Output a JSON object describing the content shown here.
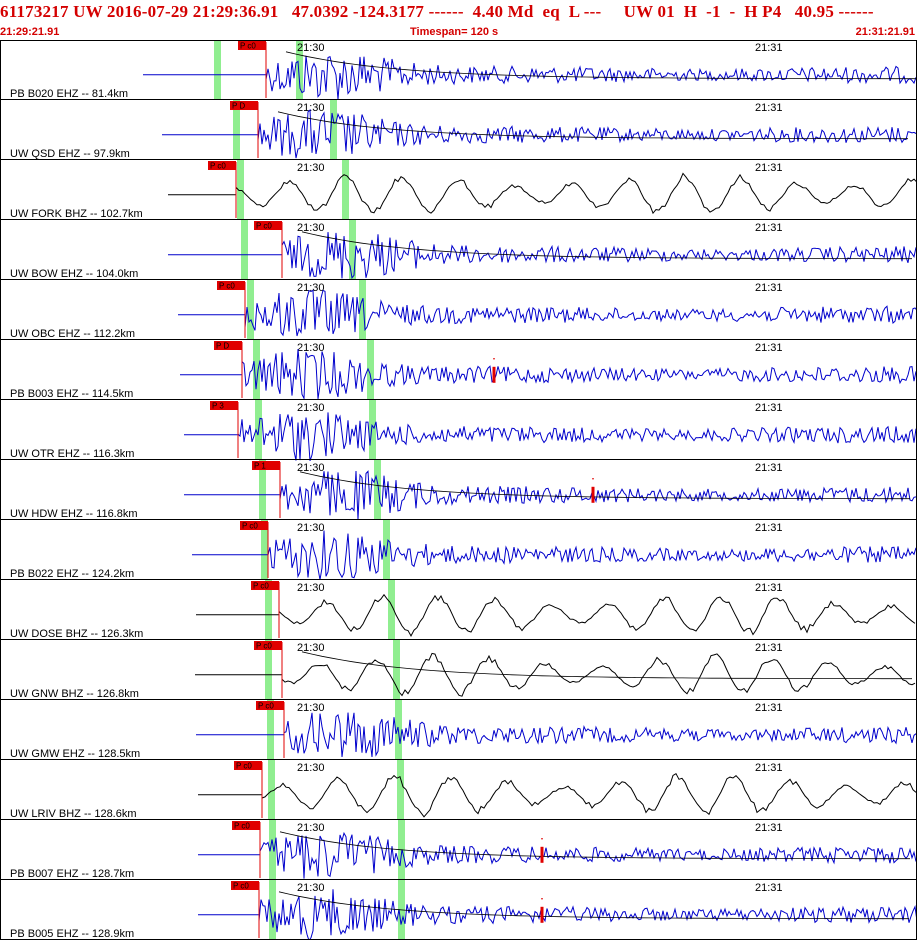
{
  "header": {
    "title": "61173217 UW 2016-07-29 21:29:36.91   47.0392 -124.3177 ------  4.40 Md  eq  L ---     UW 01  H  -1  -  H P4   40.95 ------",
    "start_time": "21:29:21.91",
    "timespan": "Timespan= 120 s",
    "end_time": "21:31:21.91"
  },
  "time_labels": [
    "21:30",
    "21:31"
  ],
  "colors": {
    "header_text": "#d40000",
    "pick_marker": "#e00000",
    "s_window": "#90ee90",
    "waveform_short_period": "#0000cc",
    "waveform_broadband": "#000000",
    "coda_curve": "#000000",
    "border": "#000000"
  },
  "channels": [
    {
      "label": "PB B020 EHZ -- 81.4km",
      "phase": "P c0",
      "type": "short-period",
      "coda": true,
      "s_pick": false
    },
    {
      "label": "UW QSD EHZ -- 97.9km",
      "phase": "P D",
      "type": "short-period",
      "coda": true,
      "s_pick": false
    },
    {
      "label": "UW FORK BHZ -- 102.7km",
      "phase": "P c0",
      "type": "broadband",
      "coda": false,
      "s_pick": false
    },
    {
      "label": "UW BOW EHZ -- 104.0km",
      "phase": "P c0",
      "type": "short-period",
      "coda": true,
      "s_pick": false
    },
    {
      "label": "UW OBC EHZ -- 112.2km",
      "phase": "P c0",
      "type": "short-period",
      "coda": false,
      "s_pick": false
    },
    {
      "label": "PB B003 EHZ -- 114.5km",
      "phase": "P D",
      "type": "short-period",
      "coda": false,
      "s_pick": true
    },
    {
      "label": "UW OTR EHZ -- 116.3km",
      "phase": "P 3",
      "type": "short-period",
      "coda": false,
      "s_pick": false
    },
    {
      "label": "UW HDW EHZ -- 116.8km",
      "phase": "P 1",
      "type": "short-period",
      "coda": true,
      "s_pick": true
    },
    {
      "label": "PB B022 EHZ -- 124.2km",
      "phase": "P c0",
      "type": "short-period",
      "coda": false,
      "s_pick": false
    },
    {
      "label": "UW DOSE BHZ -- 126.3km",
      "phase": "P c0",
      "type": "broadband",
      "coda": false,
      "s_pick": false
    },
    {
      "label": "UW GNW BHZ -- 126.8km",
      "phase": "P c0",
      "type": "broadband",
      "coda": true,
      "s_pick": false
    },
    {
      "label": "UW GMW EHZ -- 128.5km",
      "phase": "P c0",
      "type": "short-period",
      "coda": false,
      "s_pick": false
    },
    {
      "label": "UW LRIV BHZ -- 128.6km",
      "phase": "P c0",
      "type": "broadband",
      "coda": false,
      "s_pick": false
    },
    {
      "label": "PB B007 EHZ -- 128.7km",
      "phase": "P c0",
      "type": "short-period",
      "coda": true,
      "s_pick": true
    },
    {
      "label": "PB B005 EHZ -- 128.9km",
      "phase": "P c0",
      "type": "short-period",
      "coda": true,
      "s_pick": true
    }
  ]
}
